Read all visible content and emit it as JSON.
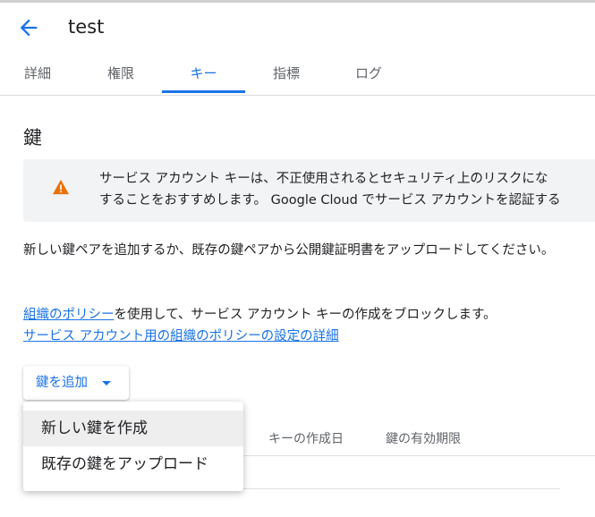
{
  "header": {
    "title": "test",
    "back_icon": "arrow-left-icon"
  },
  "tabs": [
    {
      "label": "詳細"
    },
    {
      "label": "権限"
    },
    {
      "label": "キー",
      "active": true
    },
    {
      "label": "指標"
    },
    {
      "label": "ログ"
    }
  ],
  "section": {
    "title": "鍵"
  },
  "warning": {
    "icon": "warning-icon",
    "line1": "サービス アカウント キーは、不正使用されるとセキュリティ上のリスクにな",
    "line2": "することをおすすめします。 Google Cloud でサービス アカウントを認証する"
  },
  "description": "新しい鍵ペアを追加するか、既存の鍵ペアから公開鍵証明書をアップロードしてください。",
  "policy": {
    "link1": "組織のポリシー",
    "text": "を使用して、サービス アカウント キーの作成をブロックします。",
    "link2": "サービス アカウント用の組織のポリシーの設定の詳細"
  },
  "add_key_button": {
    "label": "鍵を追加"
  },
  "table": {
    "columns": [
      "キーの作成日",
      "鍵の有効期限"
    ]
  },
  "menu": {
    "items": [
      {
        "label": "新しい鍵を作成"
      },
      {
        "label": "既存の鍵をアップロード"
      }
    ]
  },
  "colors": {
    "accent": "#1a73e8",
    "warning": "#e8710a"
  }
}
